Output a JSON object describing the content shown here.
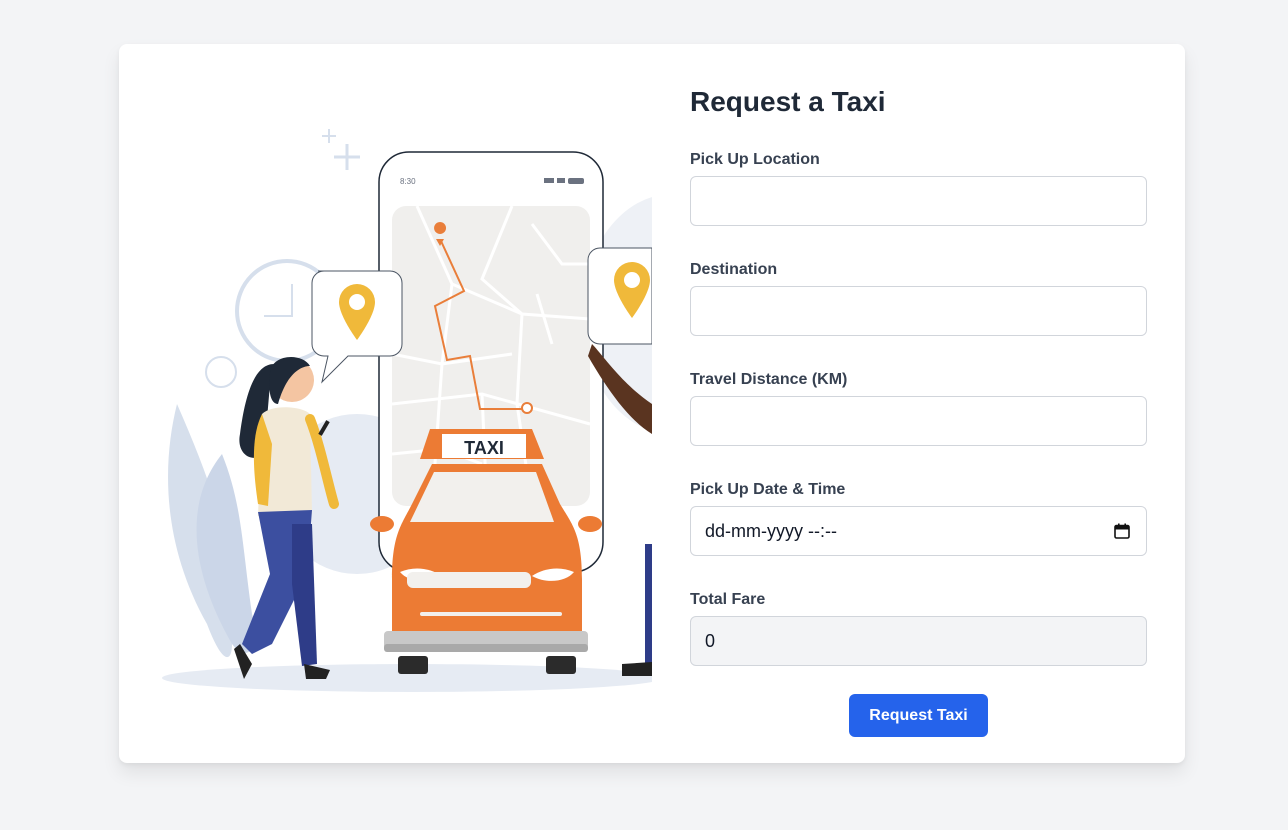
{
  "form": {
    "title": "Request a Taxi",
    "pickup": {
      "label": "Pick Up Location",
      "value": ""
    },
    "destination": {
      "label": "Destination",
      "value": ""
    },
    "distance": {
      "label": "Travel Distance (KM)",
      "value": ""
    },
    "datetime": {
      "label": "Pick Up Date & Time",
      "placeholder": "dd-mm-yyyy --:--"
    },
    "fare": {
      "label": "Total Fare",
      "value": "0"
    },
    "submit_label": "Request Taxi"
  },
  "illustration": {
    "taxi_sign": "TAXI",
    "phone_time": "8:30",
    "colors": {
      "taxi": "#ec7b34",
      "pin": "#f0b93a",
      "route": "#e97e3a",
      "button": "#2563eb"
    }
  }
}
